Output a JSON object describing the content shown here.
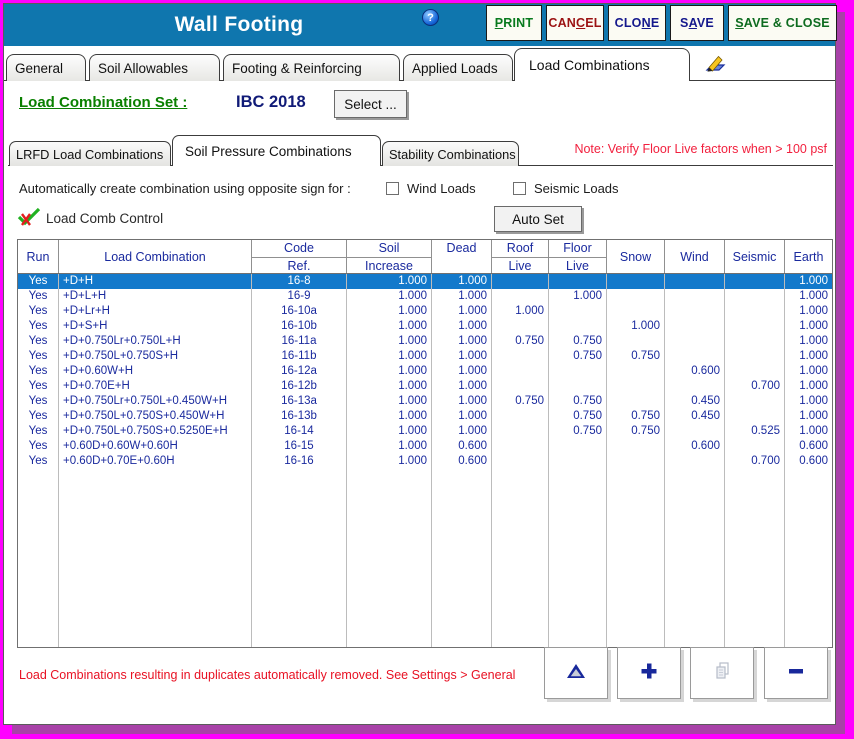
{
  "colors": {
    "frame_border": "#ff00ff",
    "titlebar_blue": "#0f76ae",
    "selection_blue": "#1379cb",
    "table_text_navy": "#1a2a9e",
    "note_red": "#f2203e",
    "footer_red": "#e81123",
    "label_green": "#0a8000",
    "value_navy": "#101a77"
  },
  "titlebar": {
    "title": "Wall Footing",
    "help": "?",
    "buttons": [
      {
        "label": "PRINT",
        "pre": "",
        "u": "P",
        "post": "RINT",
        "color": "#087a1e"
      },
      {
        "label": "CANCEL",
        "pre": "CAN",
        "u": "C",
        "post": "EL",
        "color": "#9b1212"
      },
      {
        "label": "CLONE",
        "pre": "CLO",
        "u": "N",
        "post": "E",
        "color": "#14188c"
      },
      {
        "label": "SAVE",
        "pre": "S",
        "u": "A",
        "post": "VE",
        "color": "#14188c"
      },
      {
        "label": "SAVE & CLOSE",
        "pre": "",
        "u": "S",
        "post": "AVE & CLOSE",
        "color": "#0d6b1f"
      }
    ]
  },
  "tabs": {
    "items": [
      "General",
      "Soil Allowables",
      "Footing & Reinforcing",
      "Applied Loads",
      "Load Combinations"
    ],
    "active": "Load Combinations"
  },
  "combo_set": {
    "label": "Load Combination Set :",
    "value": "IBC 2018",
    "select_button": "Select ..."
  },
  "subtabs": {
    "items": [
      "LRFD Load Combinations",
      "Soil Pressure Combinations",
      "Stability Combinations"
    ],
    "active": "Soil Pressure Combinations",
    "note": "Note: Verify Floor Live factors when > 100 psf"
  },
  "options": {
    "auto_create_label": "Automatically create combination using opposite sign for :",
    "wind_checkbox": {
      "label": "Wind Loads",
      "checked": false
    },
    "seismic_checkbox": {
      "label": "Seismic Loads",
      "checked": false
    },
    "load_comb_control_label": "Load Comb Control",
    "auto_set_button": "Auto Set"
  },
  "table": {
    "selected_row": 0,
    "columns": [
      {
        "l1": "Run",
        "l2": ""
      },
      {
        "l1": "Load Combination",
        "l2": ""
      },
      {
        "l1": "Code",
        "l2": "Ref."
      },
      {
        "l1": "Soil",
        "l2": "Increase"
      },
      {
        "l1": "Dead",
        "l2": ""
      },
      {
        "l1": "Roof",
        "l2": "Live"
      },
      {
        "l1": "Floor",
        "l2": "Live"
      },
      {
        "l1": "Snow",
        "l2": ""
      },
      {
        "l1": "Wind",
        "l2": ""
      },
      {
        "l1": "Seismic",
        "l2": ""
      },
      {
        "l1": "Earth",
        "l2": ""
      }
    ],
    "rows": [
      [
        "Yes",
        "+D+H",
        "16-8",
        "1.000",
        "1.000",
        "",
        "",
        "",
        "",
        "",
        "1.000"
      ],
      [
        "Yes",
        "+D+L+H",
        "16-9",
        "1.000",
        "1.000",
        "",
        "1.000",
        "",
        "",
        "",
        "1.000"
      ],
      [
        "Yes",
        "+D+Lr+H",
        "16-10a",
        "1.000",
        "1.000",
        "1.000",
        "",
        "",
        "",
        "",
        "1.000"
      ],
      [
        "Yes",
        "+D+S+H",
        "16-10b",
        "1.000",
        "1.000",
        "",
        "",
        "1.000",
        "",
        "",
        "1.000"
      ],
      [
        "Yes",
        "+D+0.750Lr+0.750L+H",
        "16-11a",
        "1.000",
        "1.000",
        "0.750",
        "0.750",
        "",
        "",
        "",
        "1.000"
      ],
      [
        "Yes",
        "+D+0.750L+0.750S+H",
        "16-11b",
        "1.000",
        "1.000",
        "",
        "0.750",
        "0.750",
        "",
        "",
        "1.000"
      ],
      [
        "Yes",
        "+D+0.60W+H",
        "16-12a",
        "1.000",
        "1.000",
        "",
        "",
        "",
        "0.600",
        "",
        "1.000"
      ],
      [
        "Yes",
        "+D+0.70E+H",
        "16-12b",
        "1.000",
        "1.000",
        "",
        "",
        "",
        "",
        "0.700",
        "1.000"
      ],
      [
        "Yes",
        "+D+0.750Lr+0.750L+0.450W+H",
        "16-13a",
        "1.000",
        "1.000",
        "0.750",
        "0.750",
        "",
        "0.450",
        "",
        "1.000"
      ],
      [
        "Yes",
        "+D+0.750L+0.750S+0.450W+H",
        "16-13b",
        "1.000",
        "1.000",
        "",
        "0.750",
        "0.750",
        "0.450",
        "",
        "1.000"
      ],
      [
        "Yes",
        "+D+0.750L+0.750S+0.5250E+H",
        "16-14",
        "1.000",
        "1.000",
        "",
        "0.750",
        "0.750",
        "",
        "0.525",
        "1.000"
      ],
      [
        "Yes",
        "+0.60D+0.60W+0.60H",
        "16-15",
        "1.000",
        "0.600",
        "",
        "",
        "",
        "0.600",
        "",
        "0.600"
      ],
      [
        "Yes",
        "+0.60D+0.70E+0.60H",
        "16-16",
        "1.000",
        "0.600",
        "",
        "",
        "",
        "",
        "0.700",
        "0.600"
      ]
    ]
  },
  "footer": {
    "note": "Load Combinations resulting in duplicates automatically removed. See Settings > General",
    "buttons": [
      "move-up-triangle",
      "add",
      "copy",
      "remove"
    ]
  }
}
